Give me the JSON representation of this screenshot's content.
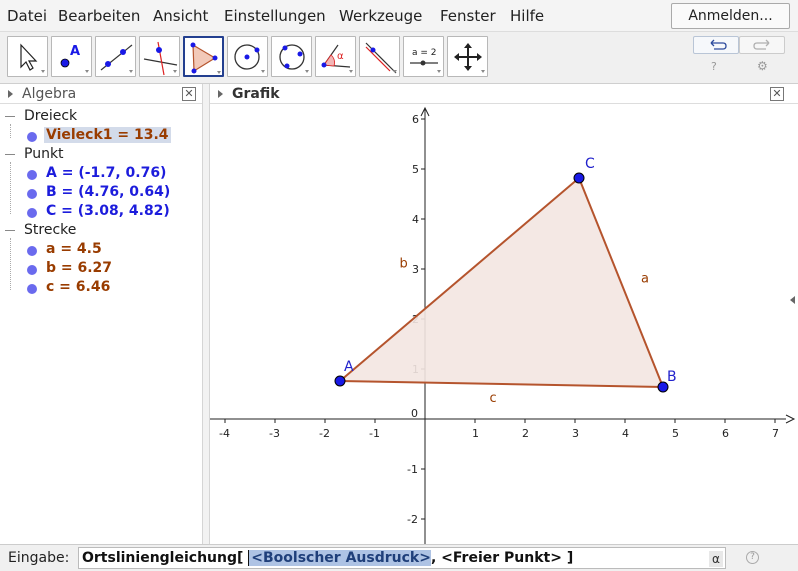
{
  "menubar": {
    "items": [
      "Datei",
      "Bearbeiten",
      "Ansicht",
      "Einstellungen",
      "Werkzeuge",
      "Fenster",
      "Hilfe"
    ],
    "sign_in_label": "Anmelden..."
  },
  "toolbar": {
    "tools": [
      {
        "name": "move-tool-icon"
      },
      {
        "name": "point-tool-icon",
        "text": "A"
      },
      {
        "name": "line-tool-icon"
      },
      {
        "name": "perpendicular-line-tool-icon"
      },
      {
        "name": "polygon-tool-icon",
        "selected": true
      },
      {
        "name": "circle-center-point-tool-icon"
      },
      {
        "name": "circle-three-points-tool-icon"
      },
      {
        "name": "angle-tool-icon",
        "text": "α"
      },
      {
        "name": "reflect-tool-icon"
      },
      {
        "name": "slider-tool-icon",
        "text": "a = 2"
      },
      {
        "name": "move-graphics-view-tool-icon"
      }
    ],
    "undo_icon": "undo-icon",
    "redo_icon": "redo-icon"
  },
  "algebra": {
    "title": "Algebra",
    "groups": [
      {
        "label": "Dreieck",
        "items": [
          {
            "text": "Vieleck1 = 13.4",
            "kind": "poly",
            "selected": true
          }
        ]
      },
      {
        "label": "Punkt",
        "items": [
          {
            "text": "A = (-1.7, 0.76)",
            "kind": "point"
          },
          {
            "text": "B = (4.76, 0.64)",
            "kind": "point"
          },
          {
            "text": "C = (3.08, 4.82)",
            "kind": "point"
          }
        ]
      },
      {
        "label": "Strecke",
        "items": [
          {
            "text": "a = 4.5",
            "kind": "seg"
          },
          {
            "text": "b = 6.27",
            "kind": "seg"
          },
          {
            "text": "c = 6.46",
            "kind": "seg"
          }
        ]
      }
    ]
  },
  "graphics": {
    "title": "Grafik",
    "x_ticks": [
      "-4",
      "-3",
      "-2",
      "-1",
      "0",
      "1",
      "2",
      "3",
      "4",
      "5",
      "6",
      "7"
    ],
    "y_ticks": [
      "-2",
      "-1",
      "1",
      "2",
      "3",
      "4",
      "5",
      "6"
    ],
    "origin_label": "0",
    "points": [
      {
        "label": "A",
        "x": -1.7,
        "y": 0.76
      },
      {
        "label": "B",
        "x": 4.76,
        "y": 0.64
      },
      {
        "label": "C",
        "x": 3.08,
        "y": 4.82
      }
    ],
    "segments": [
      {
        "label": "a",
        "from": "B",
        "to": "C"
      },
      {
        "label": "b",
        "from": "A",
        "to": "C"
      },
      {
        "label": "c",
        "from": "A",
        "to": "B"
      }
    ],
    "colors": {
      "polygon_fill": "#f3e6e1",
      "polygon_stroke": "#b5542d",
      "point_fill": "#1919e6",
      "point_label": "#2222cc"
    }
  },
  "input": {
    "label": "Eingabe:",
    "command_prefix": "Ortsliniengleichung[ ",
    "selected_arg": "<Boolscher Ausdruck>",
    "command_rest": ", <Freier Punkt> ]",
    "alpha_label": "α",
    "help_icon": "help-icon"
  }
}
